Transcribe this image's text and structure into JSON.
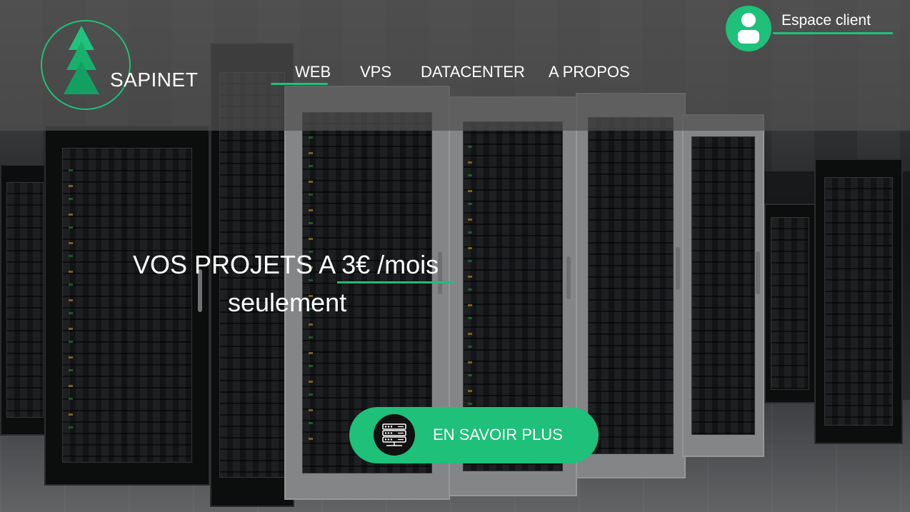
{
  "brand": {
    "name": "SAPINET"
  },
  "nav": {
    "items": [
      {
        "label": "WEB",
        "active": true
      },
      {
        "label": "VPS",
        "active": false
      },
      {
        "label": "DATACENTER",
        "active": false
      },
      {
        "label": "A PROPOS",
        "active": false
      }
    ]
  },
  "client": {
    "label": "Espace client",
    "icon": "user-icon"
  },
  "hero": {
    "line1": "VOS PROJETS A 3€ /mois",
    "line2": "seulement"
  },
  "cta": {
    "label": "EN SAVOIR PLUS",
    "icon": "server-icon"
  },
  "colors": {
    "accent": "#1ec07a",
    "header_bg": "#505050"
  }
}
